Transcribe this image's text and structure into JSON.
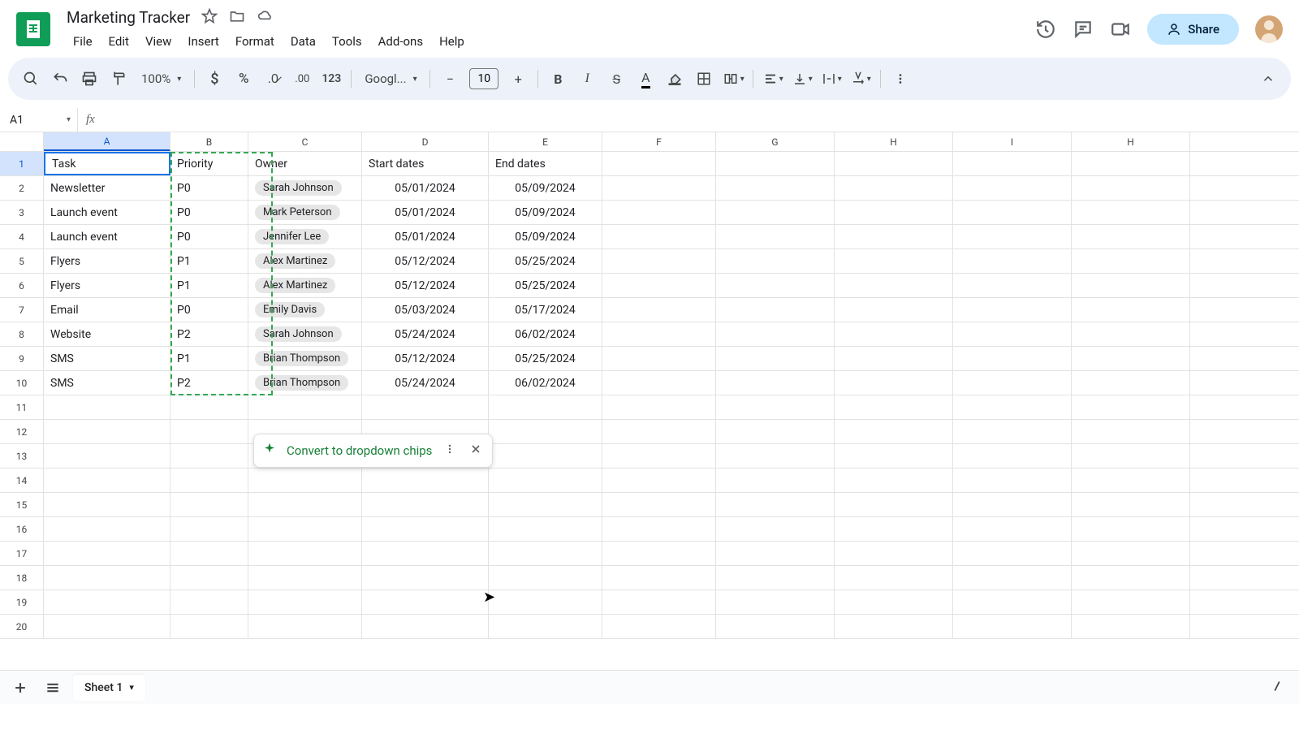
{
  "doc": {
    "title": "Marketing Tracker"
  },
  "menu": [
    "File",
    "Edit",
    "View",
    "Insert",
    "Format",
    "Data",
    "Tools",
    "Add-ons",
    "Help"
  ],
  "share": "Share",
  "toolbar": {
    "zoom": "100%",
    "font": "Googl...",
    "fontSize": "10"
  },
  "namebox": "A1",
  "cols": [
    "A",
    "B",
    "C",
    "D",
    "E",
    "F",
    "G",
    "H",
    "I",
    "H"
  ],
  "colSel": 0,
  "rowLabels": [
    "1",
    "2",
    "3",
    "4",
    "5",
    "6",
    "7",
    "8",
    "9",
    "10",
    "11",
    "12",
    "13",
    "14",
    "15",
    "16",
    "17",
    "18",
    "19",
    "20"
  ],
  "rowSel": 0,
  "headers": [
    "Task",
    "Priority",
    "Owner",
    "Start dates",
    "End dates"
  ],
  "data": [
    [
      "Newsletter",
      "P0",
      "Sarah Johnson",
      "05/01/2024",
      "05/09/2024"
    ],
    [
      "Launch event",
      "P0",
      "Mark Peterson",
      "05/01/2024",
      "05/09/2024"
    ],
    [
      "Launch event",
      "P0",
      "Jennifer Lee",
      "05/01/2024",
      "05/09/2024"
    ],
    [
      "Flyers",
      "P1",
      "Alex Martinez",
      "05/12/2024",
      "05/25/2024"
    ],
    [
      "Flyers",
      "P1",
      "Alex Martinez",
      "05/12/2024",
      "05/25/2024"
    ],
    [
      "Email",
      "P0",
      "Emily Davis",
      "05/03/2024",
      "05/17/2024"
    ],
    [
      "Website",
      "P2",
      "Sarah Johnson",
      "05/24/2024",
      "06/02/2024"
    ],
    [
      "SMS",
      "P1",
      "Brian Thompson",
      "05/12/2024",
      "05/25/2024"
    ],
    [
      "SMS",
      "P2",
      "Brian Thompson",
      "05/24/2024",
      "06/02/2024"
    ]
  ],
  "toast": {
    "text": "Convert to dropdown chips"
  },
  "tab": "Sheet 1"
}
